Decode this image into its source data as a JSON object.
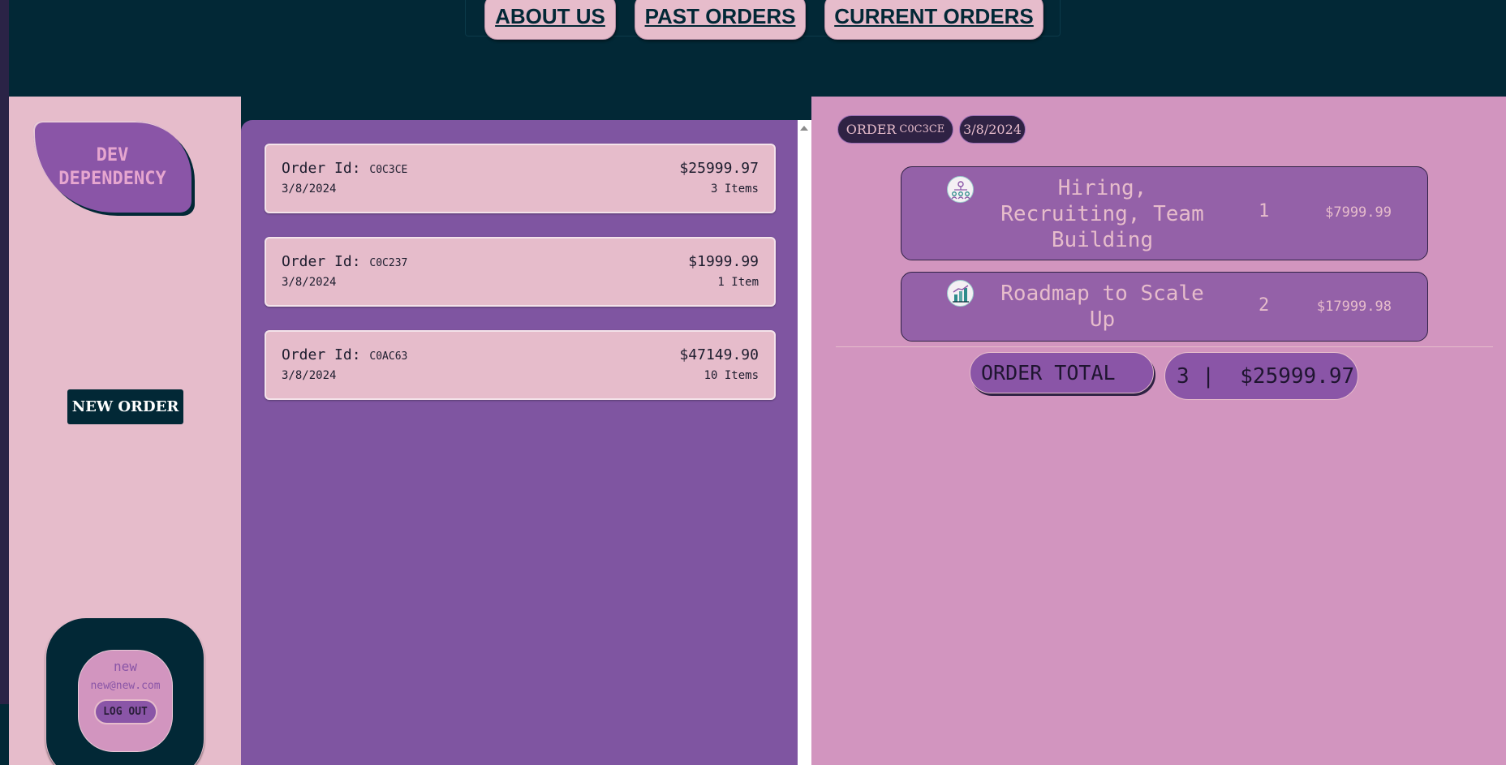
{
  "nav": {
    "about": "ABOUT US",
    "past_orders": "PAST ORDERS",
    "current_orders": "CURRENT ORDERS"
  },
  "sidebar": {
    "logo_line1": "DEV",
    "logo_line2": "DEPENDENCY",
    "new_order": "NEW ORDER",
    "user": {
      "name": "new",
      "email": "new@new.com",
      "logout": "LOG OUT"
    }
  },
  "orders": [
    {
      "id_label": "Order Id:",
      "id": "C0C3CE",
      "date": "3/8/2024",
      "total": "$25999.97",
      "items": "3 Items"
    },
    {
      "id_label": "Order Id:",
      "id": "C0C237",
      "date": "3/8/2024",
      "total": "$1999.99",
      "items": "1 Item"
    },
    {
      "id_label": "Order Id:",
      "id": "C0AC63",
      "date": "3/8/2024",
      "total": "$47149.90",
      "items": "10 Items"
    }
  ],
  "detail": {
    "order_label": "ORDER",
    "order_code": "C0C3CE",
    "date": "3/8/2024",
    "items": [
      {
        "name": "Hiring, Recruiting, Team Building",
        "qty": "1",
        "price": "$7999.99",
        "icon": "team-hierarchy-icon"
      },
      {
        "name": "Roadmap to Scale Up",
        "qty": "2",
        "price": "$17999.98",
        "icon": "growth-chart-icon"
      }
    ],
    "total_label": "ORDER TOTAL",
    "total_value": "3 |  $25999.97"
  },
  "colors": {
    "navy": "#022836",
    "pink": "#e6bccb",
    "purple": "#7f55a1",
    "mauve": "#d295bf",
    "dark_purple": "#2f2244"
  }
}
